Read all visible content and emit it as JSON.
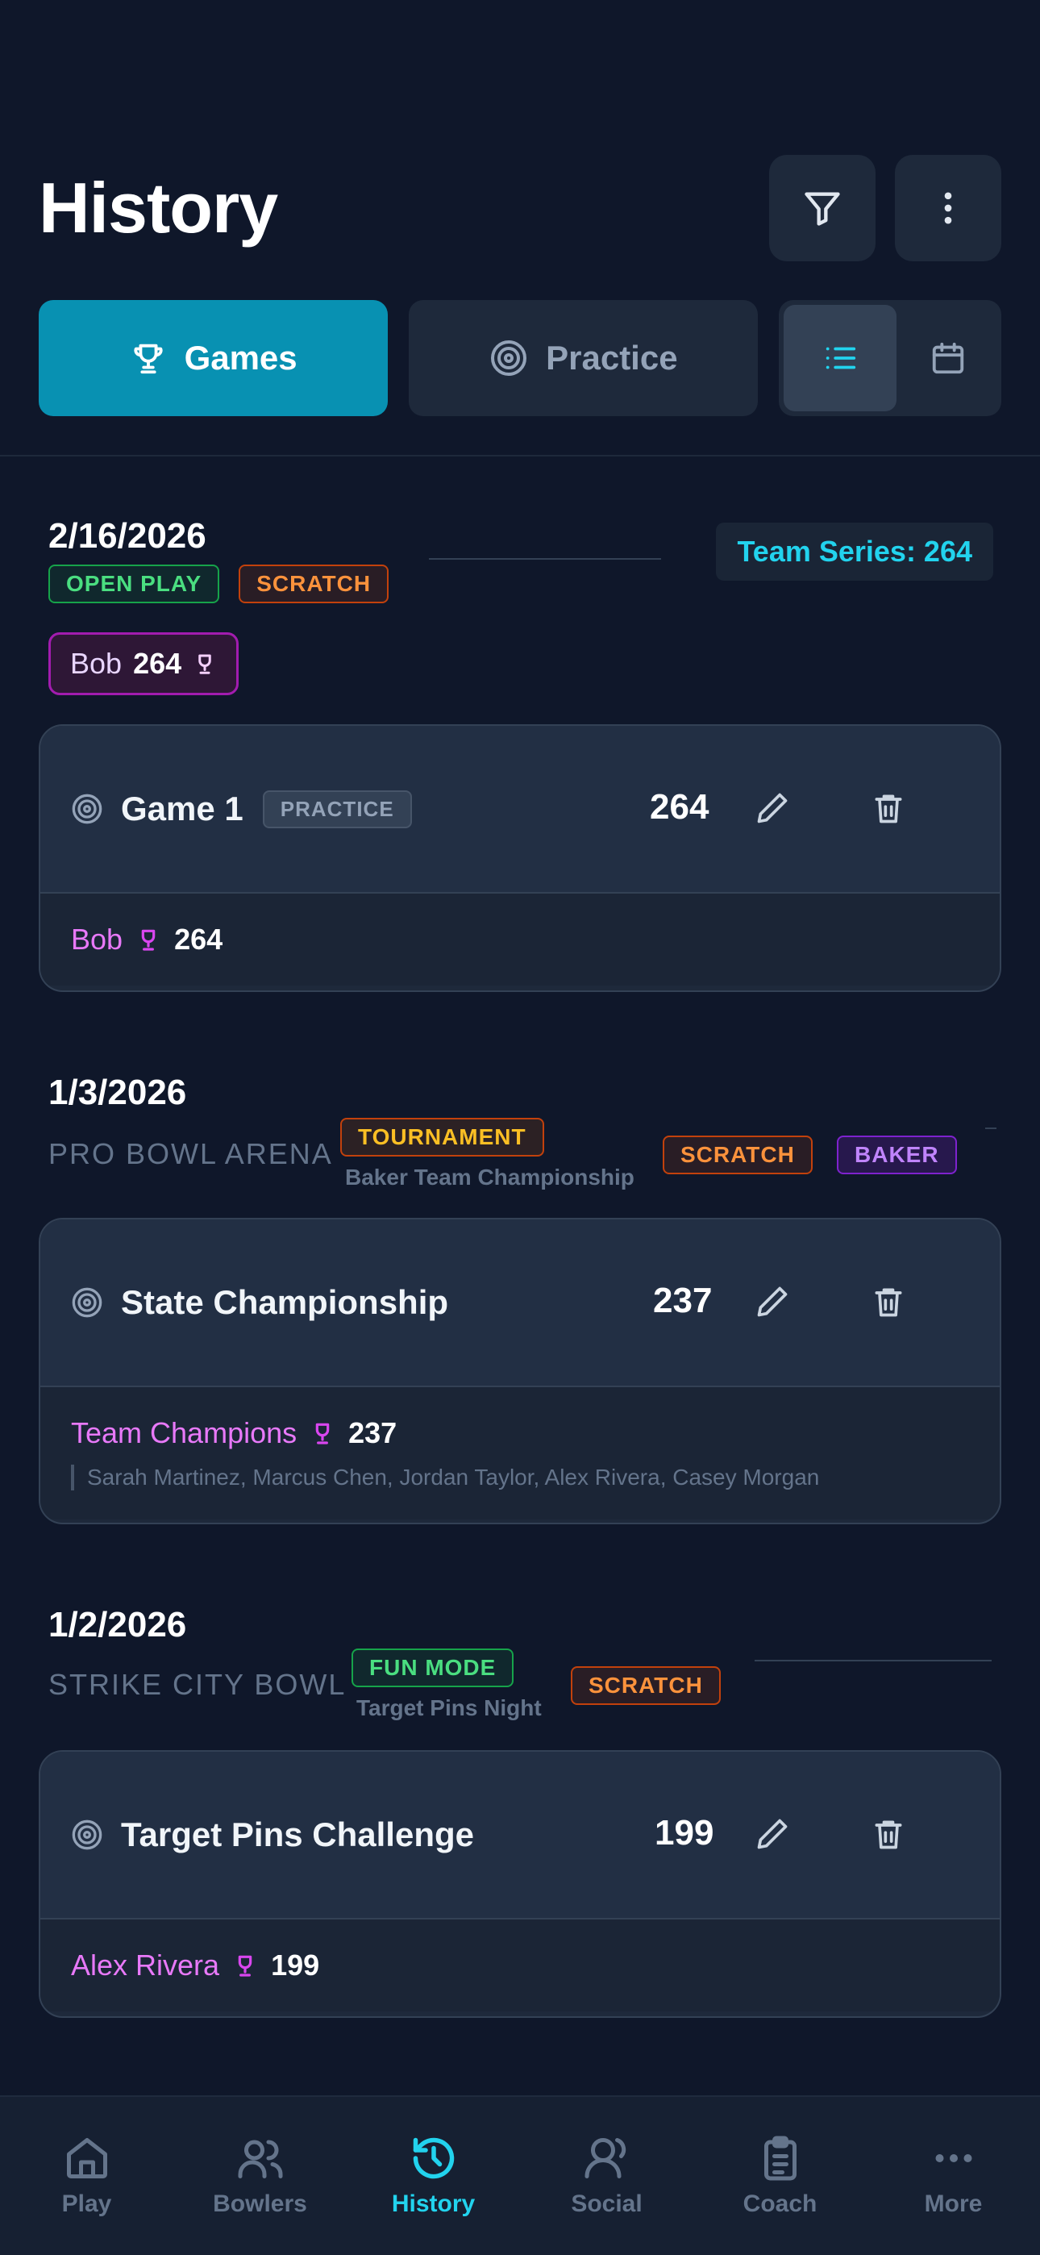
{
  "header": {
    "title": "History",
    "filter_icon": "filter-icon",
    "more_icon": "more-vertical-icon"
  },
  "tabs": {
    "games_label": "Games",
    "practice_label": "Practice",
    "selected": "Games",
    "view_modes": [
      "list",
      "calendar"
    ],
    "selected_view": "list"
  },
  "sessions": [
    {
      "date": "2/16/2026",
      "tags": [
        "OPEN PLAY",
        "SCRATCH"
      ],
      "series": "Team Series: 264",
      "bowler_chip": {
        "name": "Bob",
        "score": "264"
      },
      "game": {
        "title": "Game 1",
        "chip": "PRACTICE",
        "score": "264",
        "player": {
          "name": "Bob",
          "score": "264"
        }
      }
    },
    {
      "date": "1/3/2026",
      "venue": "PRO BOWL ARENA",
      "event_tag": "TOURNAMENT",
      "event_name": "Baker Team Championship",
      "tags": [
        "SCRATCH",
        "BAKER"
      ],
      "game": {
        "title": "State Championship",
        "score": "237",
        "player": {
          "name": "Team Champions",
          "score": "237"
        },
        "members": "Sarah Martinez, Marcus Chen, Jordan Taylor, Alex Rivera, Casey Morgan"
      }
    },
    {
      "date": "1/2/2026",
      "venue": "STRIKE CITY BOWL",
      "event_tag": "FUN MODE",
      "event_name": "Target Pins Night",
      "tags": [
        "SCRATCH"
      ],
      "game": {
        "title": "Target Pins Challenge",
        "score": "199",
        "player": {
          "name": "Alex Rivera",
          "score": "199"
        }
      }
    }
  ],
  "bottom_nav": [
    {
      "label": "Play",
      "icon": "home-icon"
    },
    {
      "label": "Bowlers",
      "icon": "users-icon"
    },
    {
      "label": "History",
      "icon": "history-icon",
      "active": true
    },
    {
      "label": "Social",
      "icon": "social-icon"
    },
    {
      "label": "Coach",
      "icon": "clipboard-icon"
    },
    {
      "label": "More",
      "icon": "more-horizontal-icon"
    }
  ],
  "colors": {
    "background": "#0f172a",
    "accent": "#0891b2",
    "accent_text": "#22d3ee",
    "card": "#1e293b",
    "bowler_name": "#e879f9"
  }
}
